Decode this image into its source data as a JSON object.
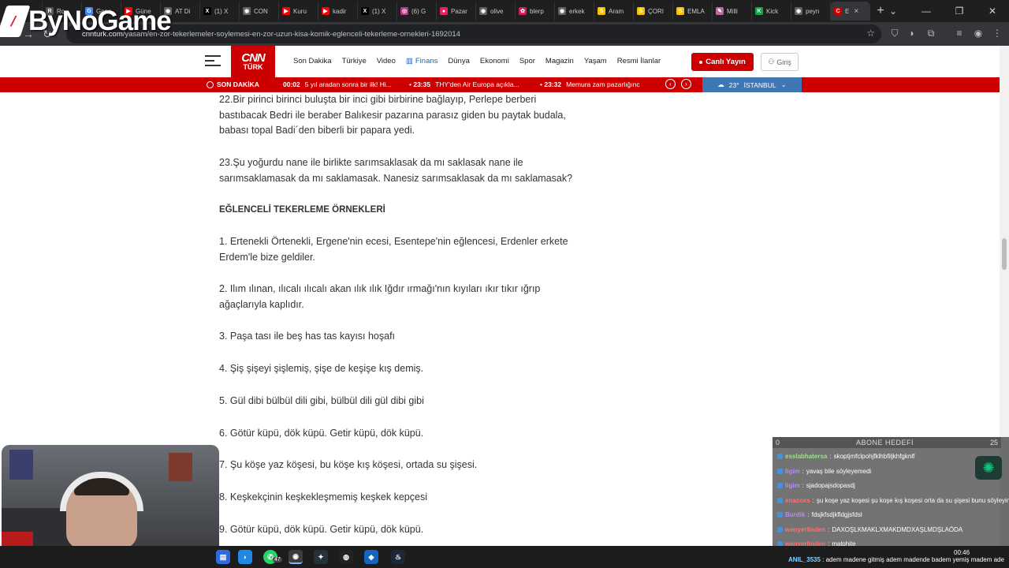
{
  "browser": {
    "tabs": [
      {
        "label": "",
        "color": "#1aa34a",
        "glyph": "K"
      },
      {
        "label": "Rc",
        "color": "#555555",
        "glyph": "R"
      },
      {
        "label": "Gene",
        "color": "#4285f4",
        "glyph": "G"
      },
      {
        "label": "Güne",
        "color": "#ff0000",
        "glyph": "▶"
      },
      {
        "label": "AT Di",
        "color": "#5f6368",
        "glyph": "◉"
      },
      {
        "label": "(1) X",
        "color": "#000000",
        "glyph": "X"
      },
      {
        "label": "CON",
        "color": "#5f6368",
        "glyph": "◉"
      },
      {
        "label": "Kuru",
        "color": "#ff0000",
        "glyph": "▶"
      },
      {
        "label": "kadir",
        "color": "#ff0000",
        "glyph": "▶"
      },
      {
        "label": "(1) X",
        "color": "#000000",
        "glyph": "X"
      },
      {
        "label": "(6) G",
        "color": "#c13584",
        "glyph": "◎"
      },
      {
        "label": "Pazar",
        "color": "#e91e63",
        "glyph": "●"
      },
      {
        "label": "olive",
        "color": "#5f6368",
        "glyph": "◉"
      },
      {
        "label": "blerp",
        "color": "#d81b60",
        "glyph": "✿"
      },
      {
        "label": "erkek",
        "color": "#5f6368",
        "glyph": "◉"
      },
      {
        "label": "Aram",
        "color": "#f4c20d",
        "glyph": "S"
      },
      {
        "label": "ÇORI",
        "color": "#f4c20d",
        "glyph": "S"
      },
      {
        "label": "EMLA",
        "color": "#f4c20d",
        "glyph": "S"
      },
      {
        "label": "Milli",
        "color": "#b76b9a",
        "glyph": "✎"
      },
      {
        "label": "Kick",
        "color": "#1aa34a",
        "glyph": "K"
      },
      {
        "label": "peyn",
        "color": "#5f6368",
        "glyph": "◉"
      },
      {
        "label": "E",
        "color": "#cc0000",
        "glyph": "C",
        "active": true
      }
    ],
    "new_tab": "+",
    "window_controls": [
      "⌄",
      "—",
      "❐",
      "✕"
    ],
    "url_host": "cnnturk.com",
    "url_path": "/yasam/en-zor-tekerlemeler-soylemesi-en-zor-uzun-kisa-komik-eglenceli-tekerleme-ornekleri-1692014",
    "bookmark_icon": "☆"
  },
  "site": {
    "logo_line1": "CNN",
    "logo_line2": "TÜRK",
    "nav": [
      "Son Dakika",
      "Türkiye",
      "Video",
      "Finans",
      "Dünya",
      "Ekonomi",
      "Spor",
      "Magazin",
      "Yaşam",
      "Resmi İlanlar"
    ],
    "live_label": "Canlı Yayın",
    "login_label": "Giriş",
    "breaking_label": "SON DAKİKA",
    "ticker": [
      {
        "time": "00:02",
        "text": "5 yıl aradan sonra bir ilk! Hi..."
      },
      {
        "time": "23:35",
        "text": "THY'den Air Europa açıkla..."
      },
      {
        "time": "23:32",
        "text": "Memura zam pazarlığınc"
      }
    ],
    "weather_temp": "23°",
    "weather_city": "İSTANBUL",
    "accent": "#cc0000"
  },
  "article": {
    "paragraphs": [
      "22.Bir pirinci birinci buluşta bir inci gibi birbirine bağlayıp, Perlepe berberi bastıbacak Bedri ile beraber Balıkesir pazarına parasız giden bu paytak budala, babası topal Badi´den biberli bir papara yedi.",
      "23.Şu yoğurdu nane ile birlikte sarımsaklasak da mı saklasak nane ile sarımsaklamasak da mı saklamasak. Nanesiz sarımsaklasak da mı saklamasak?",
      "EĞLENCELİ TEKERLEME ÖRNEKLERİ",
      "1. Ertenekli Örtenekli, Ergene'nin ecesi, Esentepe'nin eğlencesi, Erdenler erkete Erdem'le bize geldiler.",
      "2. Ilım ılınan, ılıcalı ılıcalı akan ılık ılık Iğdır ırmağı'nın kıyıları ıkır tıkır ığrıp ağaçlarıyla kaplıdır.",
      "3. Paşa tası ile beş has tas kayısı hoşafı",
      "4. Şiş şişeyi şişlemiş, şişe de keşişe kış demiş.",
      "5. Gül dibi bülbül dili gibi, bülbül dili gül dibi gibi",
      "6. Götür küpü, dök küpü. Getir küpü, dök küpü.",
      "7. Şu köşe yaz köşesi, bu köşe kış köşesi, ortada su şişesi.",
      "8. Keşkekçinin keşkekleşmemiş keşkek kepçesi",
      "9. Götür küpü, dök küpü. Getir küpü, dök küpü."
    ]
  },
  "overlay": {
    "brand": "ByNoGame",
    "goal_min": "0",
    "goal_title": "ABONE HEDEFİ",
    "goal_max": "25",
    "chat": [
      {
        "user": "esslabhatersa",
        "msg": "skoptjmfclpohjfklhbfiljkhfgknlf",
        "color": "#9be28c"
      },
      {
        "user": "ligim",
        "msg": "yavaş bile söyleyemedi",
        "color": "#b68cf0"
      },
      {
        "user": "ligim",
        "msg": "sjadopajsdopasdj",
        "color": "#b68cf0"
      },
      {
        "user": "enazoxs",
        "msg": "şu koşe yaz koşesi şu koşe kış koşesi orta da su şişesi bunu söyleyin",
        "color": "#ff6f6f"
      },
      {
        "user": "Burdik",
        "msg": "fdsjkfsdjkfldgjsfdsl",
        "color": "#b68cf0"
      },
      {
        "user": "wenyerlinden",
        "msg": "DAXOŞLKMAKLXMAKDMDXAŞLMDŞLAÖDA",
        "color": "#ff6f6f"
      },
      {
        "user": "wenyerlinden",
        "msg": "malphite",
        "color": "#ff6f6f"
      }
    ],
    "ticker_user": "ANIL_3535",
    "ticker_msg": "adem madene gitmiş adem madende badem yemiş madem ade",
    "clock": "00:46",
    "taskbar_badge": "47"
  }
}
